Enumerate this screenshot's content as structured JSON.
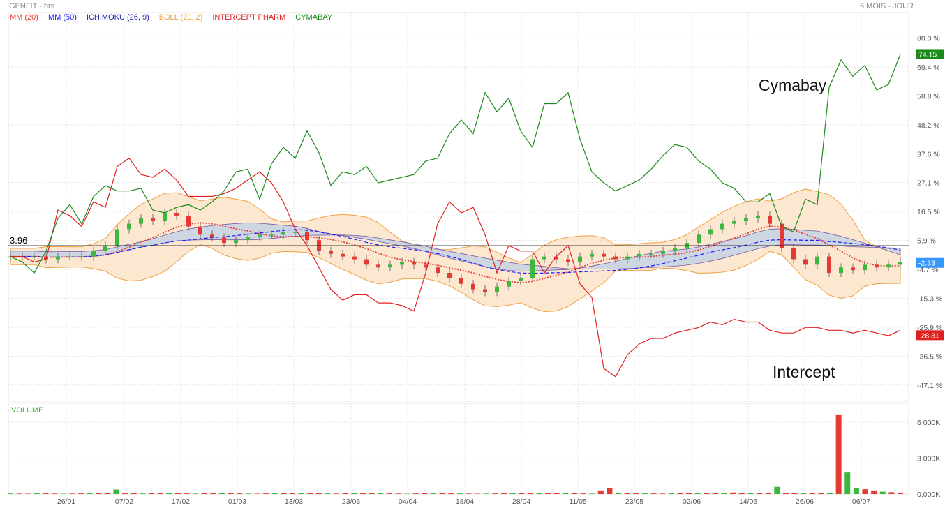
{
  "header": {
    "symbol": "GENFIT - brs",
    "period": "6 MOIS - JOUR"
  },
  "legend": [
    {
      "label": "MM (20)",
      "color": "#e53935"
    },
    {
      "label": "MM (50)",
      "color": "#1a1aff"
    },
    {
      "label": "ICHIMOKU (26, 9)",
      "color": "#2222aa"
    },
    {
      "label": "BOLL (20, 2)",
      "color": "#f0a040"
    },
    {
      "label": "INTERCEPT PHARM",
      "color": "#e02020"
    },
    {
      "label": "CYMABAY",
      "color": "#1a8a1a"
    }
  ],
  "colors": {
    "up": "#3cb83c",
    "down": "#e53935",
    "cymabay": "#1a8a1a",
    "intercept": "#e02020",
    "boll_fill": "#fbe3c8",
    "cloud_fill": "#a8c8f0",
    "volume_label": "#3cb83c"
  },
  "chart_data": {
    "type": "line",
    "y_axis_unit": "%",
    "y_ticks": [
      "80.0 %",
      "69.4 %",
      "58.8 %",
      "48.2 %",
      "37.6 %",
      "27.1 %",
      "16.5 %",
      "5.9 %",
      "-4.7 %",
      "-15.3 %",
      "-25.9 %",
      "-36.5 %",
      "-47.1 %"
    ],
    "x_ticks": [
      "26/01",
      "07/02",
      "17/02",
      "01/03",
      "13/03",
      "23/03",
      "04/04",
      "18/04",
      "28/04",
      "11/05",
      "23/05",
      "02/06",
      "14/06",
      "26/06",
      "06/07"
    ],
    "reference_line": {
      "label": "3.96",
      "value": 3.96
    },
    "last_values": {
      "cymabay": "74.15",
      "genfit": "-2.33",
      "intercept": "-28.81"
    },
    "annotations": [
      "Cymabay",
      "Intercept"
    ],
    "series": [
      {
        "name": "CYMABAY",
        "values": [
          0,
          -2,
          -6,
          2,
          14,
          19,
          12,
          22,
          26,
          24,
          24,
          25,
          17,
          16,
          18,
          19,
          17,
          20,
          24,
          31,
          32,
          21,
          34,
          40,
          36,
          46,
          38,
          26,
          31,
          30,
          33,
          27,
          28,
          29,
          30,
          35,
          36,
          45,
          50,
          45,
          60,
          53,
          58,
          46,
          40,
          56,
          56,
          60,
          43,
          31,
          27,
          24,
          26,
          28,
          32,
          37,
          41,
          40,
          35,
          32,
          27,
          25,
          20,
          20,
          23,
          11,
          9,
          21,
          19,
          62,
          72,
          66,
          70,
          61,
          63,
          74
        ]
      },
      {
        "name": "INTERCEPT PHARM",
        "values": [
          0,
          0,
          -2,
          -1,
          17,
          15,
          11,
          20,
          18,
          33,
          36,
          30,
          29,
          32,
          28,
          22,
          22,
          22,
          23,
          25,
          28,
          31,
          27,
          20,
          10,
          4,
          -4,
          -12,
          -16,
          -14,
          -14,
          -17,
          -17,
          -18,
          -20,
          -6,
          12,
          20,
          16,
          18,
          8,
          -6,
          4,
          2,
          2,
          -6,
          0,
          4,
          -10,
          -15,
          -41,
          -44,
          -36,
          -32,
          -30,
          -30,
          -28,
          -27,
          -26,
          -24,
          -25,
          -23,
          -24,
          -24,
          -27,
          -28,
          -28,
          -26,
          -26,
          -27,
          -27,
          -28,
          -27,
          -28,
          -29,
          -27
        ]
      },
      {
        "name": "GENFIT",
        "values": [
          0,
          0,
          0,
          -1,
          0,
          0,
          0,
          2,
          4,
          10,
          12,
          14,
          13,
          16,
          15,
          11,
          8,
          7,
          5,
          6,
          7,
          8,
          8,
          9,
          9,
          6,
          2,
          1,
          0,
          -1,
          -3,
          -4,
          -3,
          -2,
          -3,
          -4,
          -6,
          -8,
          -10,
          -12,
          -13,
          -11,
          -9,
          -8,
          -1,
          0,
          -1,
          -2,
          0,
          1,
          0,
          -1,
          0,
          1,
          1,
          2,
          3,
          5,
          8,
          10,
          12,
          13,
          14,
          15,
          12,
          3,
          -1,
          -3,
          0,
          -6,
          -4,
          -5,
          -3,
          -4,
          -3,
          -2
        ]
      }
    ]
  },
  "volume": {
    "label": "VOLUME",
    "y_ticks": [
      "6 000K",
      "3 000K",
      "0.000K"
    ],
    "max": 7000,
    "values": [
      50,
      40,
      30,
      60,
      50,
      40,
      30,
      40,
      50,
      60,
      60,
      80,
      380,
      70,
      60,
      50,
      60,
      80,
      70,
      60,
      50,
      40,
      60,
      80,
      70,
      60,
      50,
      40,
      30,
      50,
      60,
      70,
      80,
      90,
      70,
      60,
      50,
      40,
      60,
      70,
      80,
      90,
      60,
      50,
      40,
      30,
      50,
      60,
      70,
      80,
      60,
      50,
      40,
      30,
      40,
      50,
      60,
      70,
      80,
      90,
      60,
      70,
      80,
      70,
      60,
      50,
      40,
      300,
      500,
      90,
      80,
      70,
      60,
      50,
      40,
      60,
      60,
      80,
      90,
      100,
      110,
      120,
      130,
      100,
      90,
      80,
      70,
      600,
      120,
      100,
      90,
      70,
      80,
      90,
      6600,
      1800,
      500,
      400,
      300,
      200,
      150,
      120
    ]
  }
}
